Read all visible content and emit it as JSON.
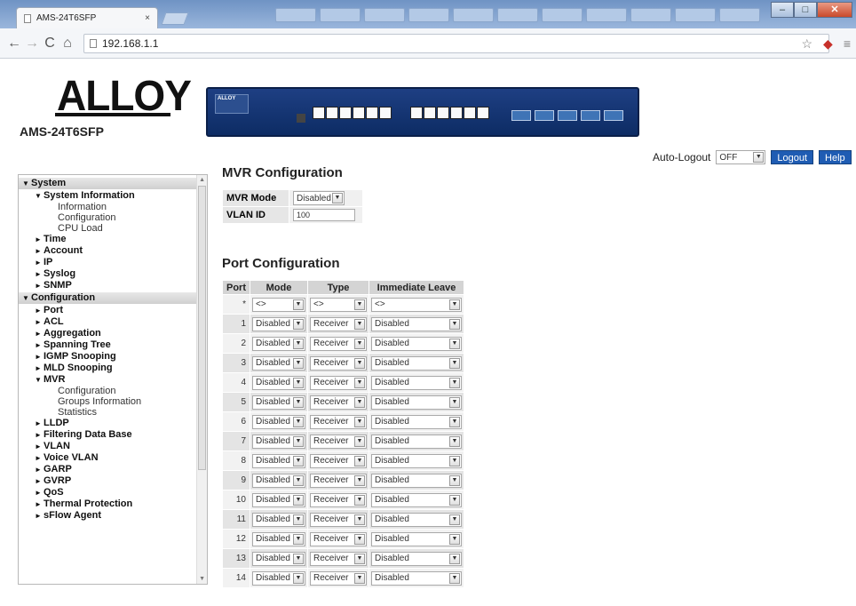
{
  "browser": {
    "tab_title": "AMS-24T6SFP",
    "tab_close": "×",
    "url": "192.168.1.1"
  },
  "header": {
    "logo": "ALLOY",
    "model": "AMS-24T6SFP",
    "autologout_label": "Auto-Logout",
    "autologout_value": "OFF",
    "logout_label": "Logout",
    "help_label": "Help"
  },
  "sidebar": {
    "items": [
      {
        "type": "sec",
        "marker": "▼",
        "label": "System"
      },
      {
        "type": "grp",
        "marker": "▼",
        "label": "System Information"
      },
      {
        "type": "leaf",
        "marker": "",
        "label": "Information"
      },
      {
        "type": "leaf",
        "marker": "",
        "label": "Configuration"
      },
      {
        "type": "leaf",
        "marker": "",
        "label": "CPU Load"
      },
      {
        "type": "grp",
        "marker": "►",
        "label": "Time"
      },
      {
        "type": "grp",
        "marker": "►",
        "label": "Account"
      },
      {
        "type": "grp",
        "marker": "►",
        "label": "IP"
      },
      {
        "type": "grp",
        "marker": "►",
        "label": "Syslog"
      },
      {
        "type": "grp",
        "marker": "►",
        "label": "SNMP"
      },
      {
        "type": "sec",
        "marker": "▼",
        "label": "Configuration"
      },
      {
        "type": "grp",
        "marker": "►",
        "label": "Port"
      },
      {
        "type": "grp",
        "marker": "►",
        "label": "ACL"
      },
      {
        "type": "grp",
        "marker": "►",
        "label": "Aggregation"
      },
      {
        "type": "grp",
        "marker": "►",
        "label": "Spanning Tree"
      },
      {
        "type": "grp",
        "marker": "►",
        "label": "IGMP Snooping"
      },
      {
        "type": "grp",
        "marker": "►",
        "label": "MLD Snooping"
      },
      {
        "type": "grp",
        "marker": "▼",
        "label": "MVR"
      },
      {
        "type": "leaf",
        "marker": "",
        "label": "Configuration"
      },
      {
        "type": "leaf",
        "marker": "",
        "label": "Groups Information"
      },
      {
        "type": "leaf",
        "marker": "",
        "label": "Statistics"
      },
      {
        "type": "grp",
        "marker": "►",
        "label": "LLDP"
      },
      {
        "type": "grp",
        "marker": "►",
        "label": "Filtering Data Base"
      },
      {
        "type": "grp",
        "marker": "►",
        "label": "VLAN"
      },
      {
        "type": "grp",
        "marker": "►",
        "label": "Voice VLAN"
      },
      {
        "type": "grp",
        "marker": "►",
        "label": "GARP"
      },
      {
        "type": "grp",
        "marker": "►",
        "label": "GVRP"
      },
      {
        "type": "grp",
        "marker": "►",
        "label": "QoS"
      },
      {
        "type": "grp",
        "marker": "►",
        "label": "Thermal Protection"
      },
      {
        "type": "grp",
        "marker": "►",
        "label": "sFlow Agent"
      }
    ]
  },
  "mvr": {
    "title": "MVR Configuration",
    "mode_label": "MVR Mode",
    "mode_value": "Disabled",
    "vlan_label": "VLAN ID",
    "vlan_value": "100"
  },
  "port_config": {
    "title": "Port Configuration",
    "headers": [
      "Port",
      "Mode",
      "Type",
      "Immediate Leave"
    ],
    "all_row": {
      "port": "*",
      "mode": "<>",
      "type": "<>",
      "leave": "<>"
    },
    "rows": [
      {
        "port": "1",
        "mode": "Disabled",
        "type": "Receiver",
        "leave": "Disabled"
      },
      {
        "port": "2",
        "mode": "Disabled",
        "type": "Receiver",
        "leave": "Disabled"
      },
      {
        "port": "3",
        "mode": "Disabled",
        "type": "Receiver",
        "leave": "Disabled"
      },
      {
        "port": "4",
        "mode": "Disabled",
        "type": "Receiver",
        "leave": "Disabled"
      },
      {
        "port": "5",
        "mode": "Disabled",
        "type": "Receiver",
        "leave": "Disabled"
      },
      {
        "port": "6",
        "mode": "Disabled",
        "type": "Receiver",
        "leave": "Disabled"
      },
      {
        "port": "7",
        "mode": "Disabled",
        "type": "Receiver",
        "leave": "Disabled"
      },
      {
        "port": "8",
        "mode": "Disabled",
        "type": "Receiver",
        "leave": "Disabled"
      },
      {
        "port": "9",
        "mode": "Disabled",
        "type": "Receiver",
        "leave": "Disabled"
      },
      {
        "port": "10",
        "mode": "Disabled",
        "type": "Receiver",
        "leave": "Disabled"
      },
      {
        "port": "11",
        "mode": "Disabled",
        "type": "Receiver",
        "leave": "Disabled"
      },
      {
        "port": "12",
        "mode": "Disabled",
        "type": "Receiver",
        "leave": "Disabled"
      },
      {
        "port": "13",
        "mode": "Disabled",
        "type": "Receiver",
        "leave": "Disabled"
      },
      {
        "port": "14",
        "mode": "Disabled",
        "type": "Receiver",
        "leave": "Disabled"
      }
    ]
  },
  "colors": {
    "accent": "#1f5cb3",
    "header_gray": "#d4d4d4",
    "titlebar": "#7b9ccc"
  }
}
